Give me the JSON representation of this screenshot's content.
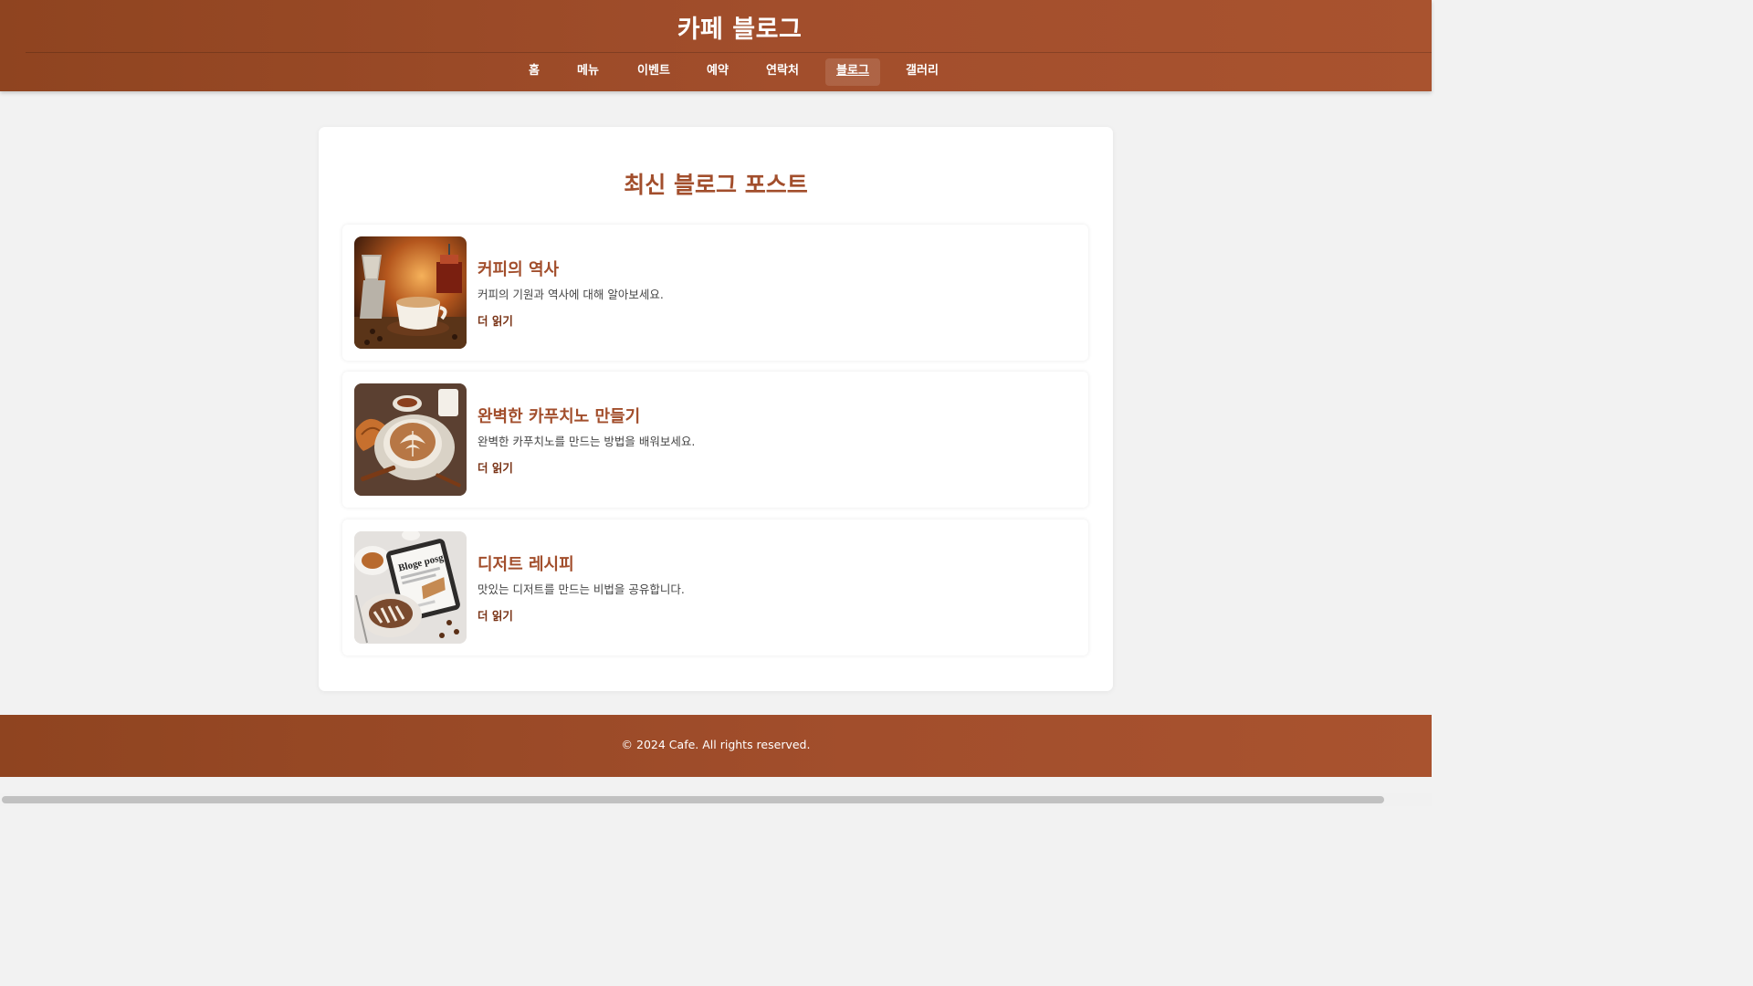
{
  "header": {
    "site_title": "카페 블로그",
    "nav": [
      {
        "label": "홈",
        "active": false
      },
      {
        "label": "메뉴",
        "active": false
      },
      {
        "label": "이벤트",
        "active": false
      },
      {
        "label": "예약",
        "active": false
      },
      {
        "label": "연락처",
        "active": false
      },
      {
        "label": "블로그",
        "active": true
      },
      {
        "label": "갤러리",
        "active": false
      }
    ]
  },
  "main": {
    "section_title": "최신 블로그 포스트",
    "posts": [
      {
        "image": "coffee-history-image",
        "title": "커피의 역사",
        "description": "커피의 기원과 역사에 대해 알아보세요.",
        "link_label": "더 읽기"
      },
      {
        "image": "cappuccino-image",
        "title": "완벽한 카푸치노 만들기",
        "description": "완벽한 카푸치노를 만드는 방법을 배워보세요.",
        "link_label": "더 읽기"
      },
      {
        "image": "dessert-recipe-image",
        "image_text": "Bloge posg",
        "title": "디저트 레시피",
        "description": "맛있는 디저트를 만드는 비법을 공유합니다.",
        "link_label": "더 읽기"
      }
    ]
  },
  "footer": {
    "text": "© 2024 Cafe. All rights reserved."
  },
  "colors": {
    "brand": "#a24e2c",
    "brand_dark": "#8f4420",
    "background": "#f2f2f2"
  }
}
